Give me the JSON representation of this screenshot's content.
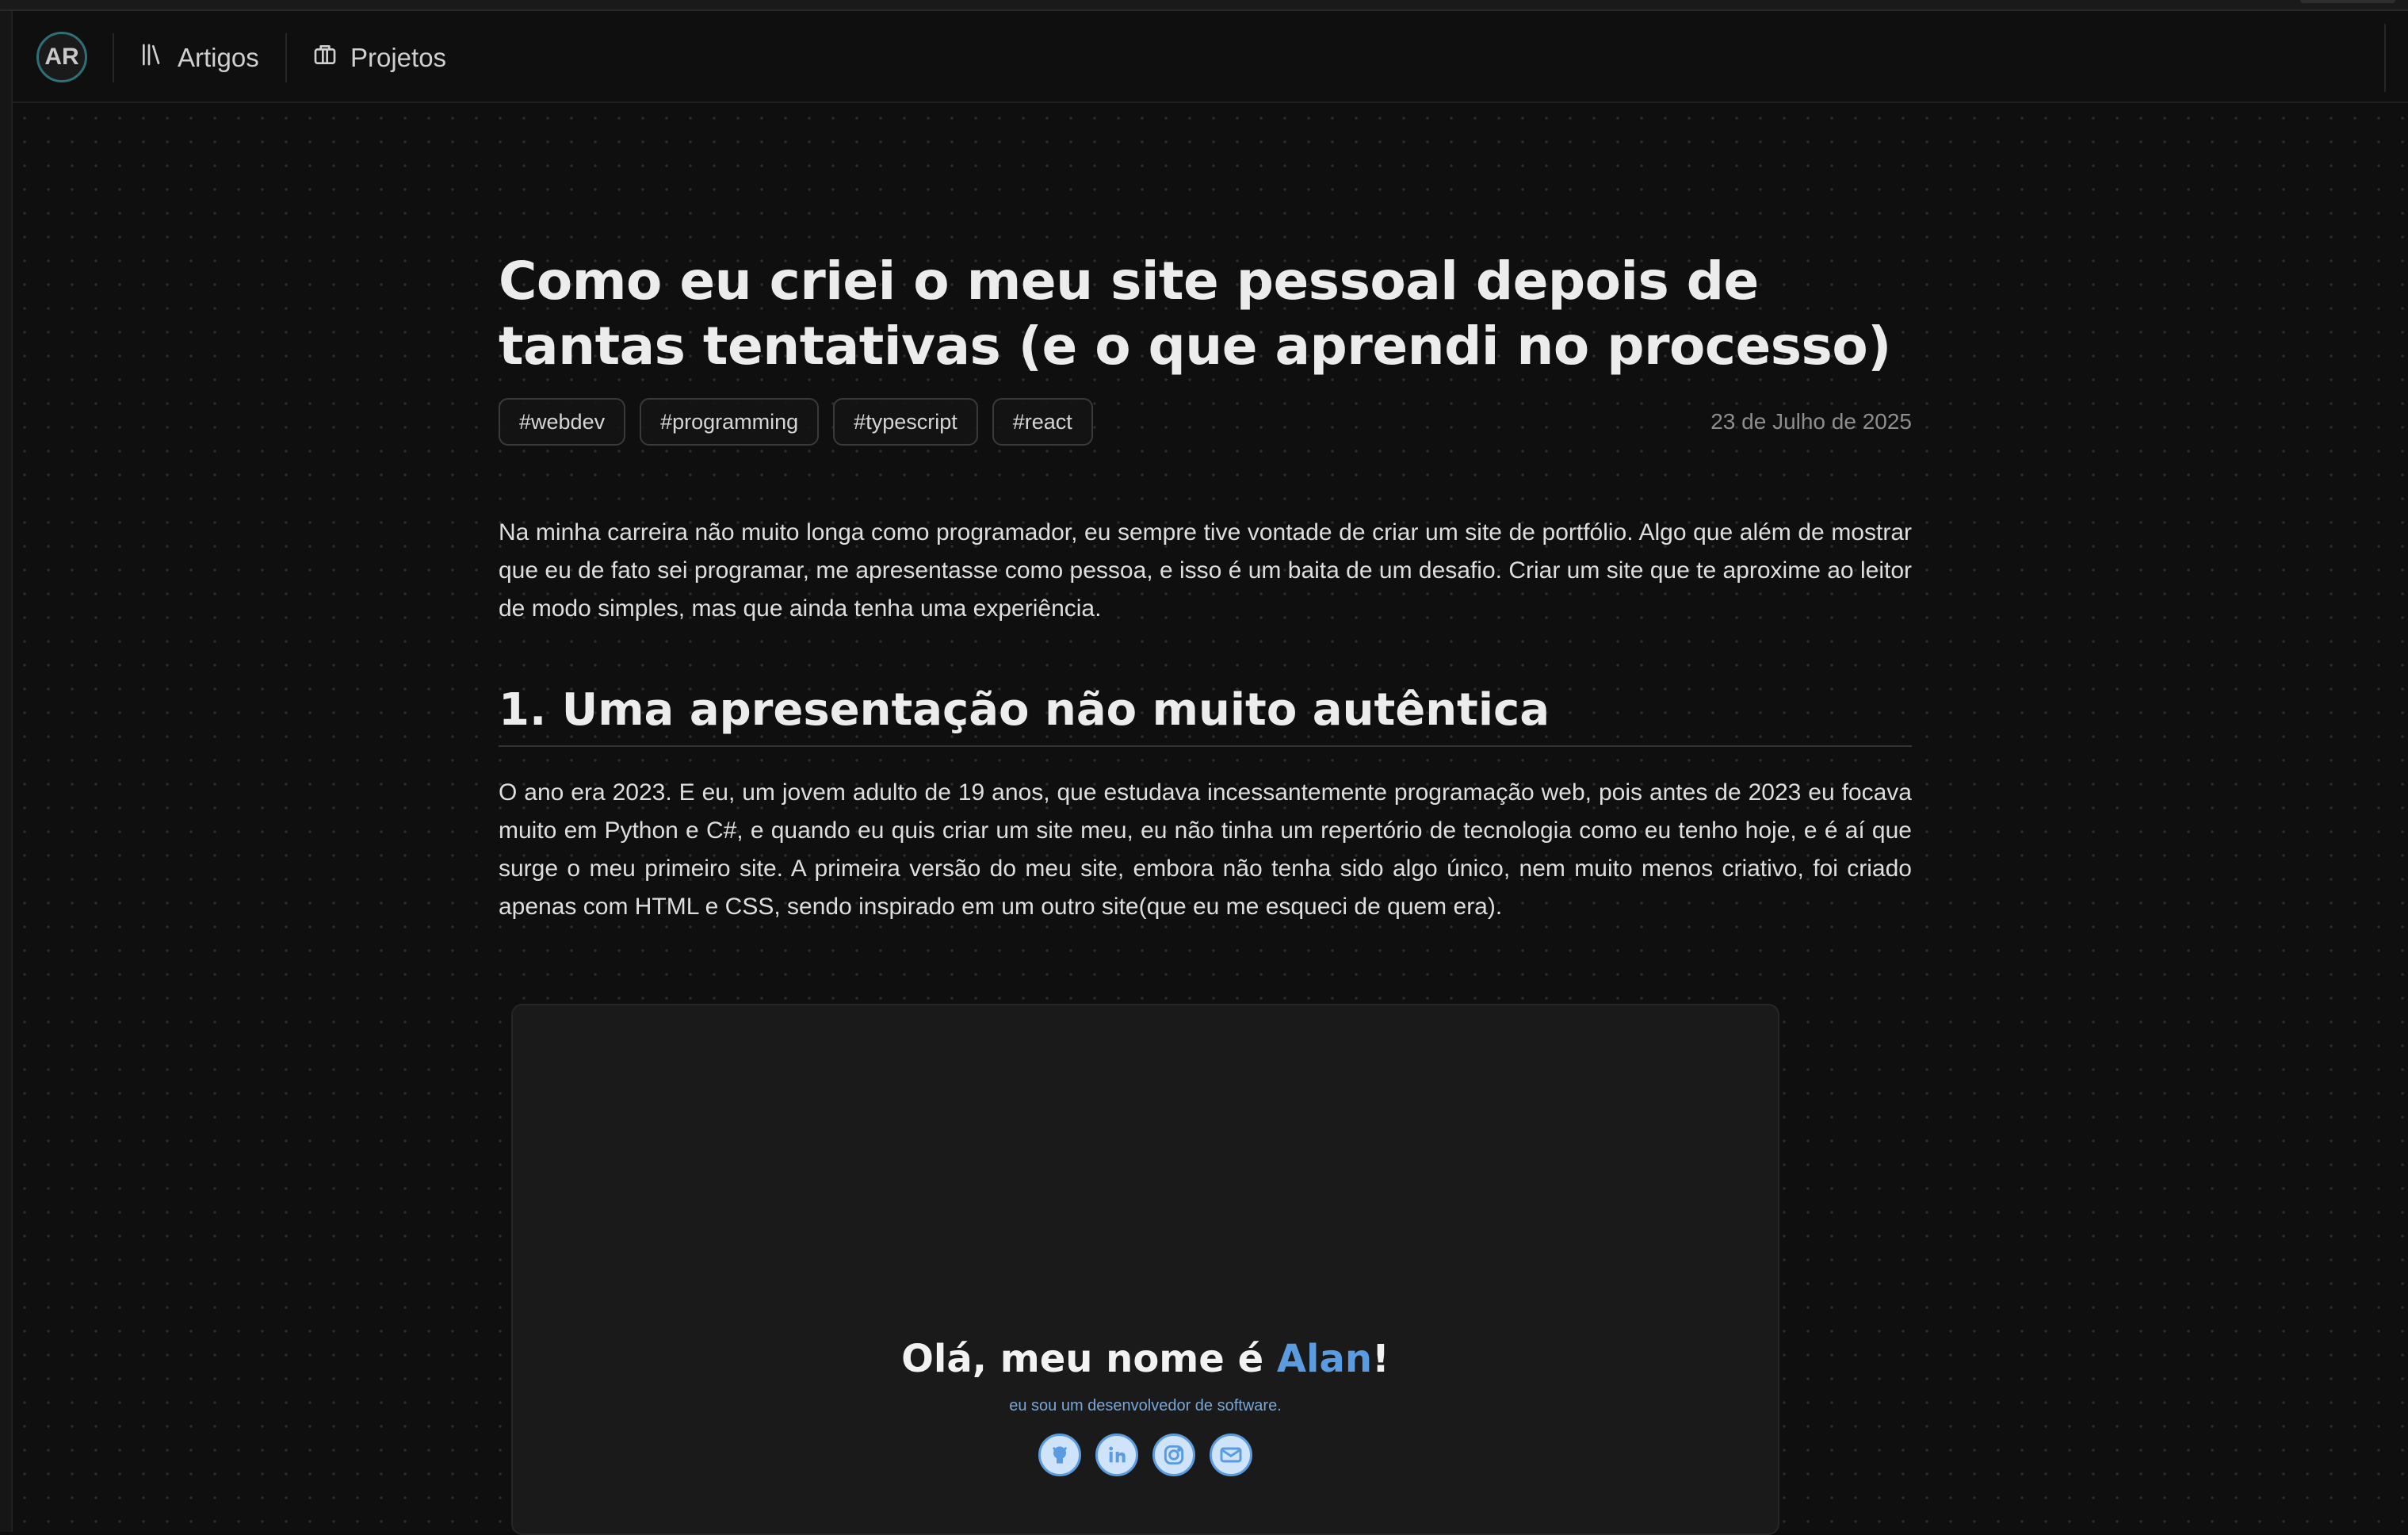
{
  "nav": {
    "avatar_text": "AR",
    "links": [
      {
        "label": "Artigos",
        "icon": "library-icon"
      },
      {
        "label": "Projetos",
        "icon": "briefcase-icon"
      }
    ]
  },
  "article": {
    "title_line1": "Como eu criei o meu site pessoal depois de",
    "title_line2": "tantas tentativas (e o que aprendi no processo)",
    "tags": [
      "#webdev",
      "#programming",
      "#typescript",
      "#react"
    ],
    "date": "23 de Julho de 2025",
    "intro": "Na minha carreira não muito longa como programador, eu sempre tive vontade de criar um site de portfólio. Algo que além de mostrar que eu de fato sei programar, me apresentasse como pessoa, e isso é um baita de um desafio. Criar um site que te aproxime ao leitor de modo simples, mas que ainda tenha uma experiência.",
    "section1_heading": "1. Uma apresentação não muito autêntica",
    "section1_paragraph": "O ano era 2023. E eu, um jovem adulto de 19 anos, que estudava incessantemente programação web, pois antes de 2023 eu focava muito em Python e C#, e quando eu quis criar um site meu, eu não tinha um repertório de tecnologia como eu tenho hoje, e é aí que surge o meu primeiro site. A primeira versão do meu site, embora não tenha sido algo único, nem muito menos criativo, foi criado apenas com HTML e CSS, sendo inspirado em um outro site(que eu me esqueci de quem era).",
    "screenshot": {
      "greeting_prefix": "Olá, meu nome é ",
      "greeting_name": "Alan",
      "greeting_suffix": "!",
      "subtitle": "eu sou um desenvolvedor de software.",
      "icons": [
        "github-icon",
        "linkedin-icon",
        "instagram-icon",
        "mail-icon"
      ]
    }
  },
  "colors": {
    "background": "#0f0f0f",
    "accent_teal": "#2f6f76",
    "accent_blue": "#5b9be0"
  }
}
